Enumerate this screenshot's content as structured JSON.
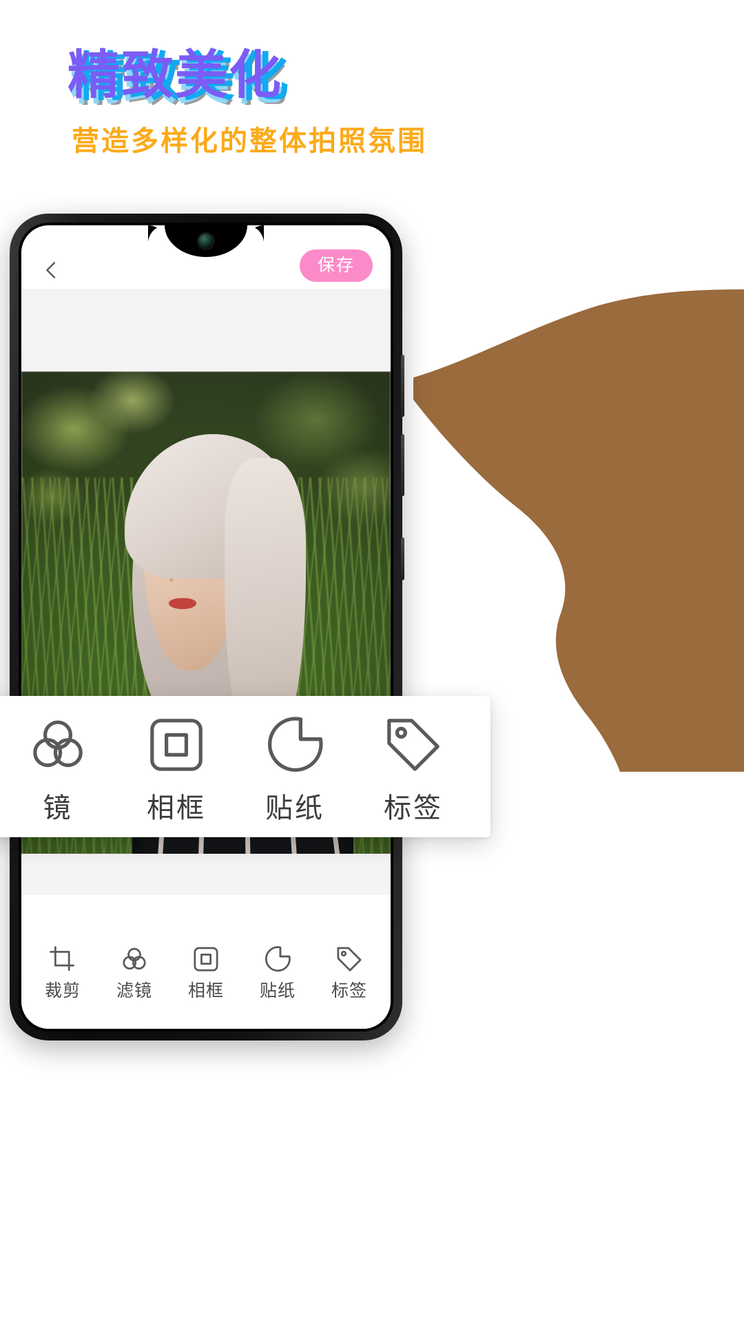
{
  "promo": {
    "headline": "精致美化",
    "subhead": "营造多样化的整体拍照氛围",
    "headline_color": "#7b5cf5",
    "headline_shadow_light_blue": "#8ed6f8",
    "headline_shadow_cyan": "#12a9f0",
    "headline_shadow_gray": "#9a9a9a",
    "subhead_color": "#fbaa19",
    "blob_color": "#9a6b3c"
  },
  "app": {
    "topbar": {
      "back_icon": "chevron-left-icon",
      "save_label": "保存",
      "save_color": "#fb8bc8"
    },
    "popup_toolbar": [
      {
        "icon": "filter-icon",
        "label": "镜"
      },
      {
        "icon": "frame-icon",
        "label": "相框"
      },
      {
        "icon": "sticker-icon",
        "label": "贴纸"
      },
      {
        "icon": "tag-icon",
        "label": "标签"
      }
    ],
    "bottom_nav": [
      {
        "icon": "crop-icon",
        "label": "裁剪"
      },
      {
        "icon": "filter-icon",
        "label": "滤镜"
      },
      {
        "icon": "frame-icon",
        "label": "相框"
      },
      {
        "icon": "sticker-icon",
        "label": "贴纸"
      },
      {
        "icon": "tag-icon",
        "label": "标签"
      }
    ]
  }
}
